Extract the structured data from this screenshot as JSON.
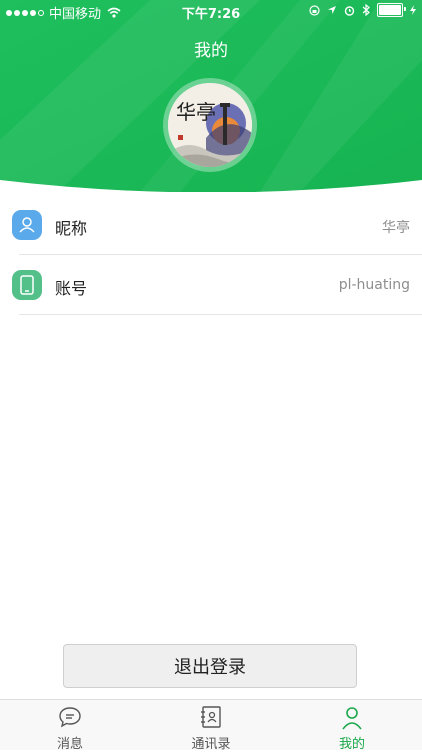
{
  "status_bar": {
    "carrier": "中国移动",
    "time": "下午7:26"
  },
  "header": {
    "title": "我的",
    "avatar_text": "华亭"
  },
  "profile": {
    "items": [
      {
        "label": "昵称",
        "value": "华亭",
        "icon": "user-icon"
      },
      {
        "label": "账号",
        "value": "pl-huating",
        "icon": "phone-icon"
      }
    ]
  },
  "logout_label": "退出登录",
  "tabs": [
    {
      "label": "消息",
      "icon": "chat-icon",
      "active": false
    },
    {
      "label": "通讯录",
      "icon": "contacts-icon",
      "active": false
    },
    {
      "label": "我的",
      "icon": "person-icon",
      "active": true
    }
  ],
  "colors": {
    "primary": "#1bbf5c",
    "header_dark": "#17a84c",
    "tab_active": "#1aa84a",
    "item_user_icon": "#5aa9ea",
    "item_phone_icon": "#53c08a"
  }
}
